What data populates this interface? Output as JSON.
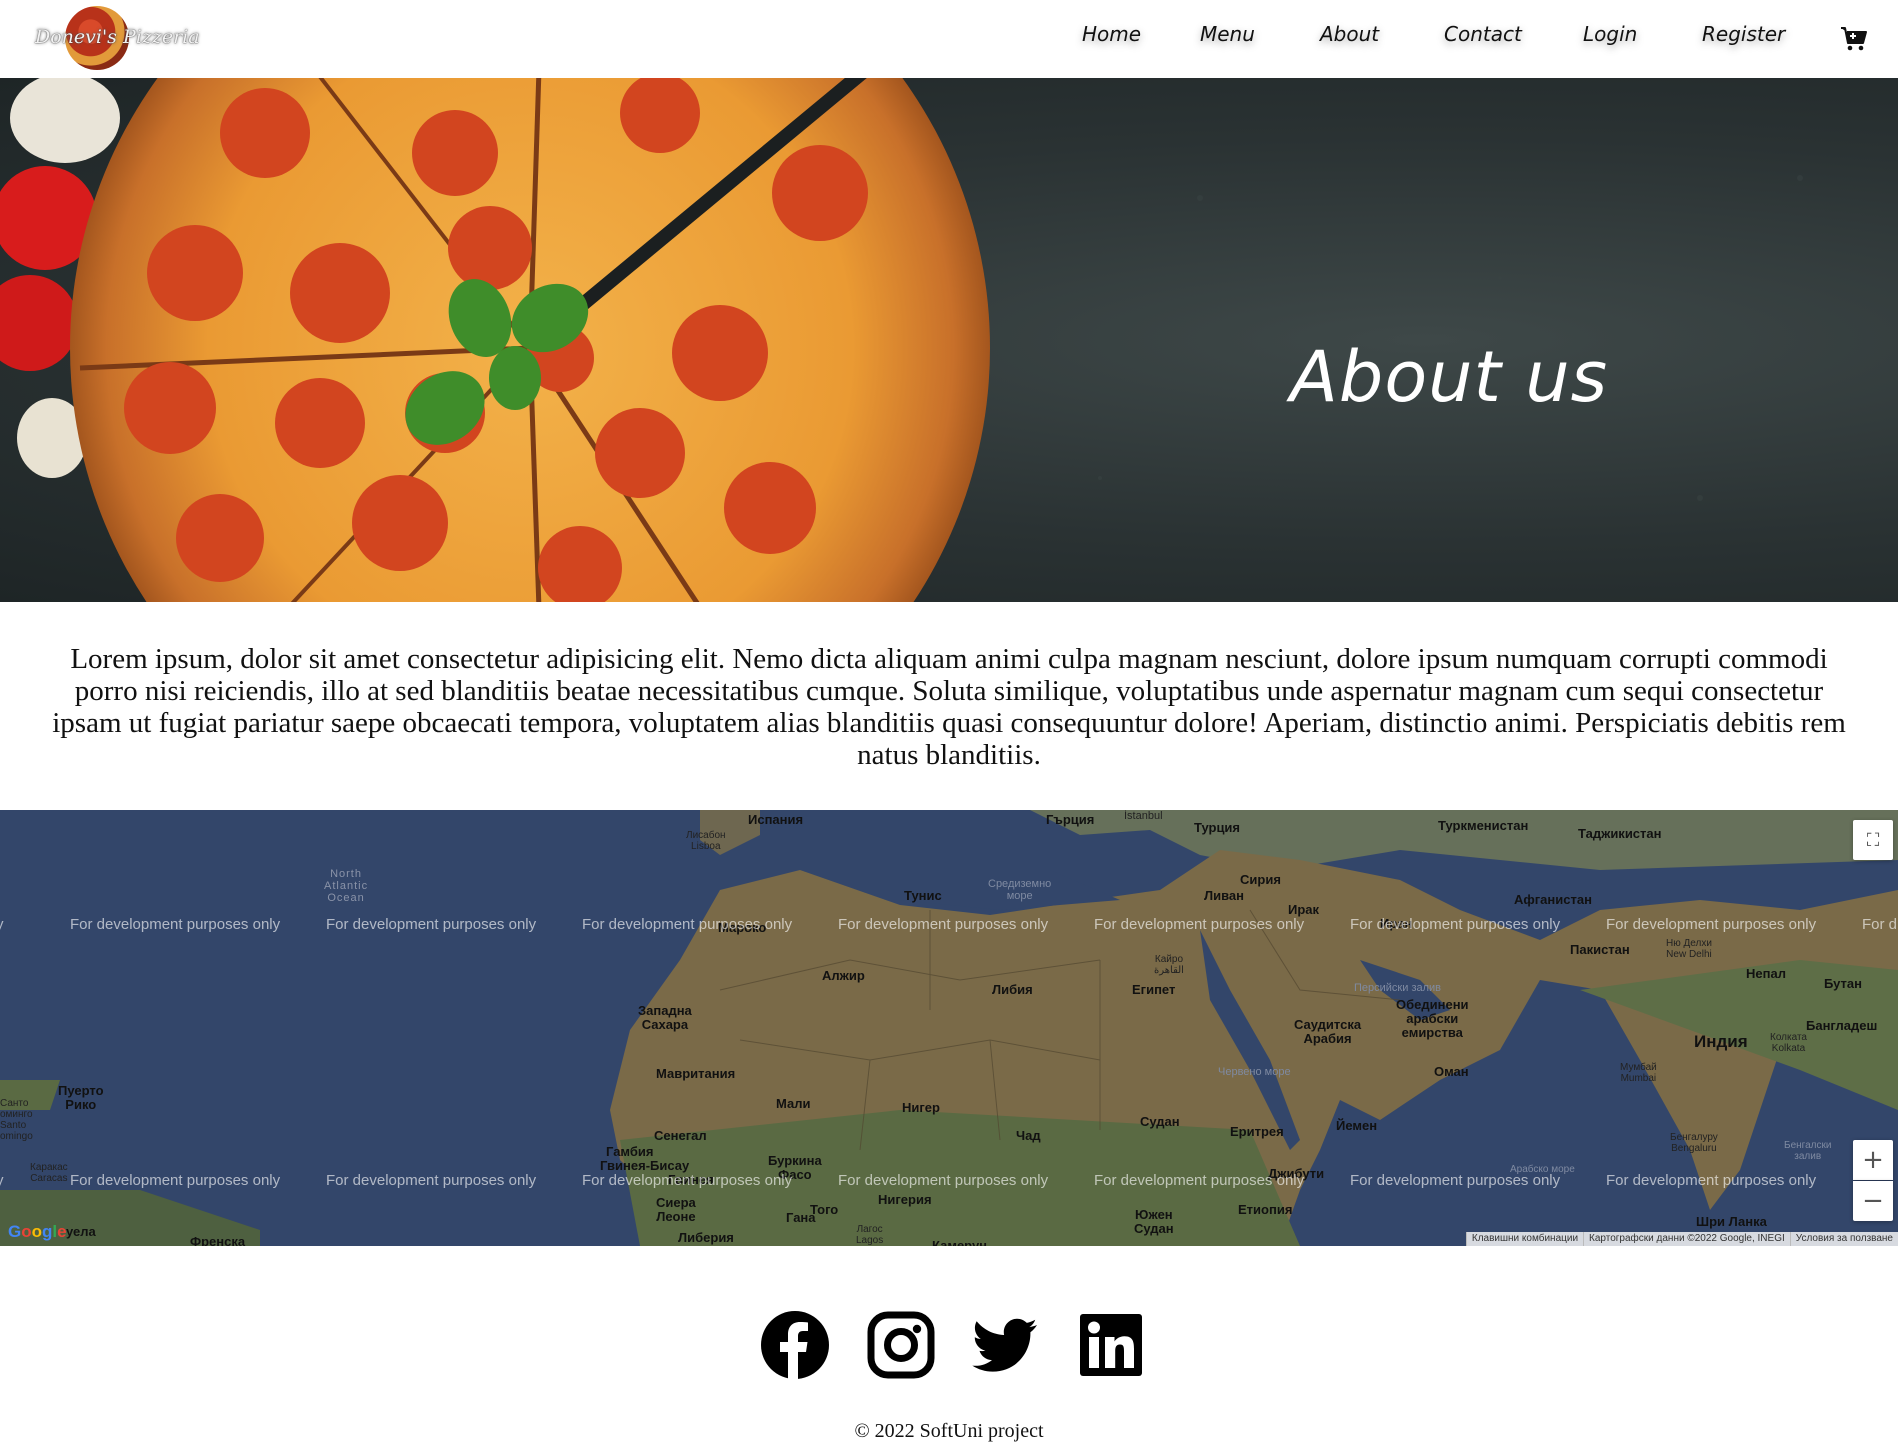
{
  "brand": {
    "logo_text": "Donevi's Pizzeria"
  },
  "nav": {
    "home": "Home",
    "menu": "Menu",
    "about": "About",
    "contact": "Contact",
    "login": "Login",
    "register": "Register",
    "cart_icon": "cart-icon"
  },
  "hero": {
    "title": "About us"
  },
  "about": {
    "text": "Lorem ipsum, dolor sit amet consectetur adipisicing elit. Nemo dicta aliquam animi culpa magnam nesciunt, dolore ipsum numquam corrupti commodi porro nisi reiciendis, illo at sed blanditiis beatae necessitatibus cumque. Soluta similique, voluptatibus unde aspernatur magnam cum sequi consectetur ipsam ut fugiat pariatur saepe obcaecati tempora, voluptatem alias blanditiis quasi consequuntur dolore! Aperiam, distinctio animi. Perspiciatis debitis rem natus blanditiis."
  },
  "map": {
    "watermark": "For development purposes only",
    "labels": {
      "spain": "Испания",
      "lisbon": "Лисабон\nLisboa",
      "greece": "Гърция",
      "istanbul": "İstanbul",
      "turkey": "Турция",
      "turkmenistan": "Туркменистан",
      "tajikistan": "Таджикистан",
      "north_atlantic": "North\nAtlantic\nOcean",
      "tunisia": "Тунис",
      "med_sea": "Средиземно\nморе",
      "syria": "Сирия",
      "lebanon": "Ливан",
      "iraq": "Ирак",
      "afghanistan": "Афганистан",
      "morocco": "Мароко",
      "iran": "Иран",
      "pakistan": "Пакистан",
      "delhi": "Ню Делхи\nNew Delhi",
      "nepal": "Непал",
      "bhutan": "Бутан",
      "algeria": "Алжир",
      "libya": "Либия",
      "egypt": "Египет",
      "cairo": "Кайро\nالقاهرة",
      "persian_gulf": "Персийски залив",
      "uae": "Обединени\nарабски\nемирства",
      "western_sahara": "Западна\nСахара",
      "saudi": "Саудитска\nАрабия",
      "india": "Индия",
      "kolkata": "Колката\nKolkata",
      "bangladesh": "Бангладеш",
      "mauritania": "Мавритания",
      "red_sea": "Червено море",
      "oman": "Оман",
      "mumbai": "Мумбай\nMumbai",
      "puerto_rico": "Пуерто\nРико",
      "santo_domingo": "Санто\nДоминго\nSanto\nDomingo",
      "mali": "Мали",
      "niger": "Нигер",
      "chad": "Чад",
      "sudan": "Судан",
      "eritrea": "Еритрея",
      "yemen": "Йемен",
      "senegal": "Сенегал",
      "gambia": "Гамбия",
      "guinea_bissau": "Гвинея-Бисау",
      "guinea": "Гвинея",
      "burkina": "Буркина\nФасо",
      "djibouti": "Джибути",
      "bengaluru": "Бенгалуру\nBengaluru",
      "bengal_bay": "Бенгалски\nзалив",
      "arabian_sea": "Арабско море",
      "caracas": "Каракас\nCaracas",
      "sierra_leone": "Сиера\nЛеоне",
      "togo": "Того",
      "nigeria": "Нигерия",
      "ghana": "Гана",
      "lagos": "Лагос\nLagos",
      "cameroon": "Камерун",
      "south_sudan": "Южен\nСудан",
      "ethiopia": "Етиопия",
      "sri_lanka": "Шри Ланка",
      "venezuela": "уела",
      "guiana": "Френска",
      "liberia": "Либерия"
    },
    "attribution": {
      "shortcuts": "Клавишни комбинации",
      "map_data": "Картографски данни ©2022 Google, INEGI",
      "terms": "Условия за ползване"
    },
    "google": "Google",
    "zoom_in": "+",
    "zoom_out": "−"
  },
  "footer": {
    "social": [
      "facebook-icon",
      "instagram-icon",
      "twitter-icon",
      "linkedin-icon"
    ],
    "copyright": "© 2022 SoftUni project"
  }
}
